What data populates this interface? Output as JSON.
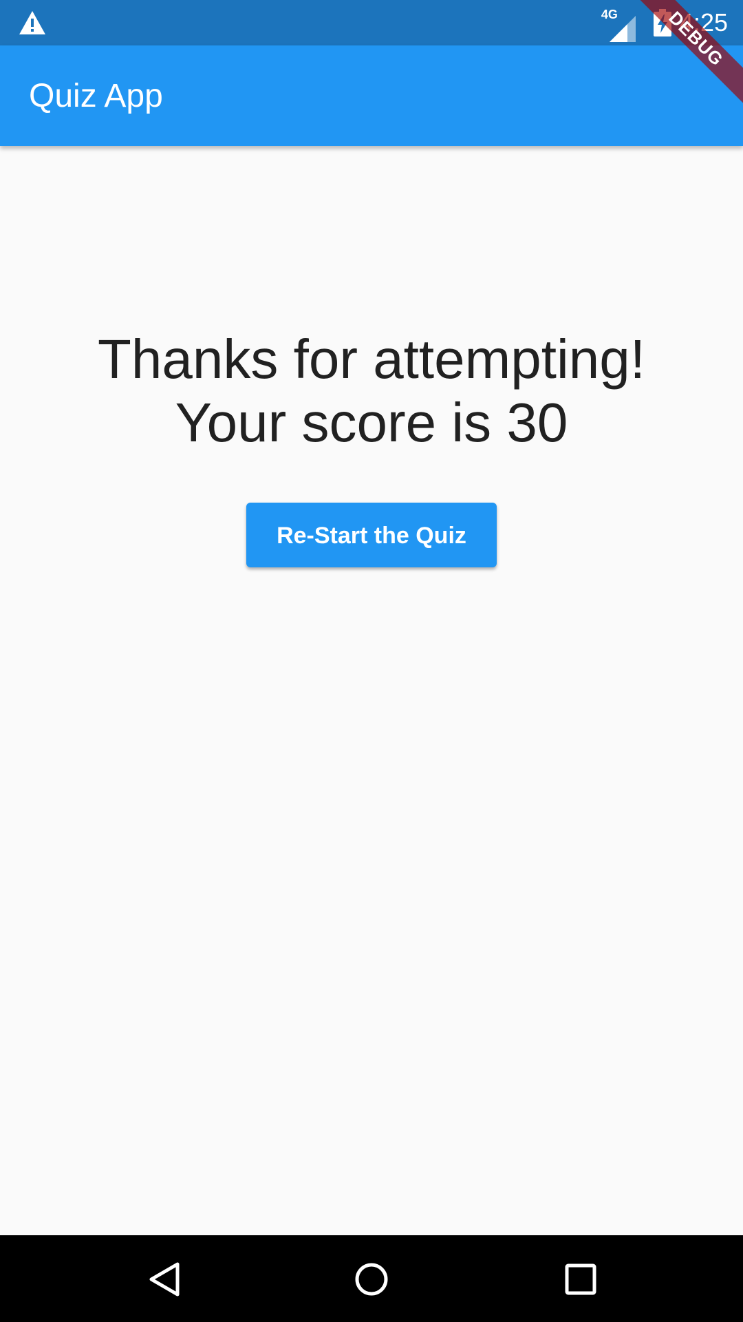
{
  "status_bar": {
    "network_type": "4G",
    "time": "4:25",
    "icons": [
      "warning-icon",
      "signal-icon",
      "battery-charging-icon"
    ]
  },
  "debug_banner": {
    "label": "DEBUG"
  },
  "app_bar": {
    "title": "Quiz App"
  },
  "result": {
    "line1": "Thanks for attempting!",
    "line2": "Your score is 30"
  },
  "restart_button": {
    "label": "Re-Start the Quiz"
  },
  "nav_bar": {
    "icons": [
      "back-icon",
      "home-icon",
      "recents-icon"
    ]
  },
  "colors": {
    "primary": "#2196f3",
    "status_bar": "#1c74bc",
    "background": "#fafafa",
    "text": "#212121"
  }
}
